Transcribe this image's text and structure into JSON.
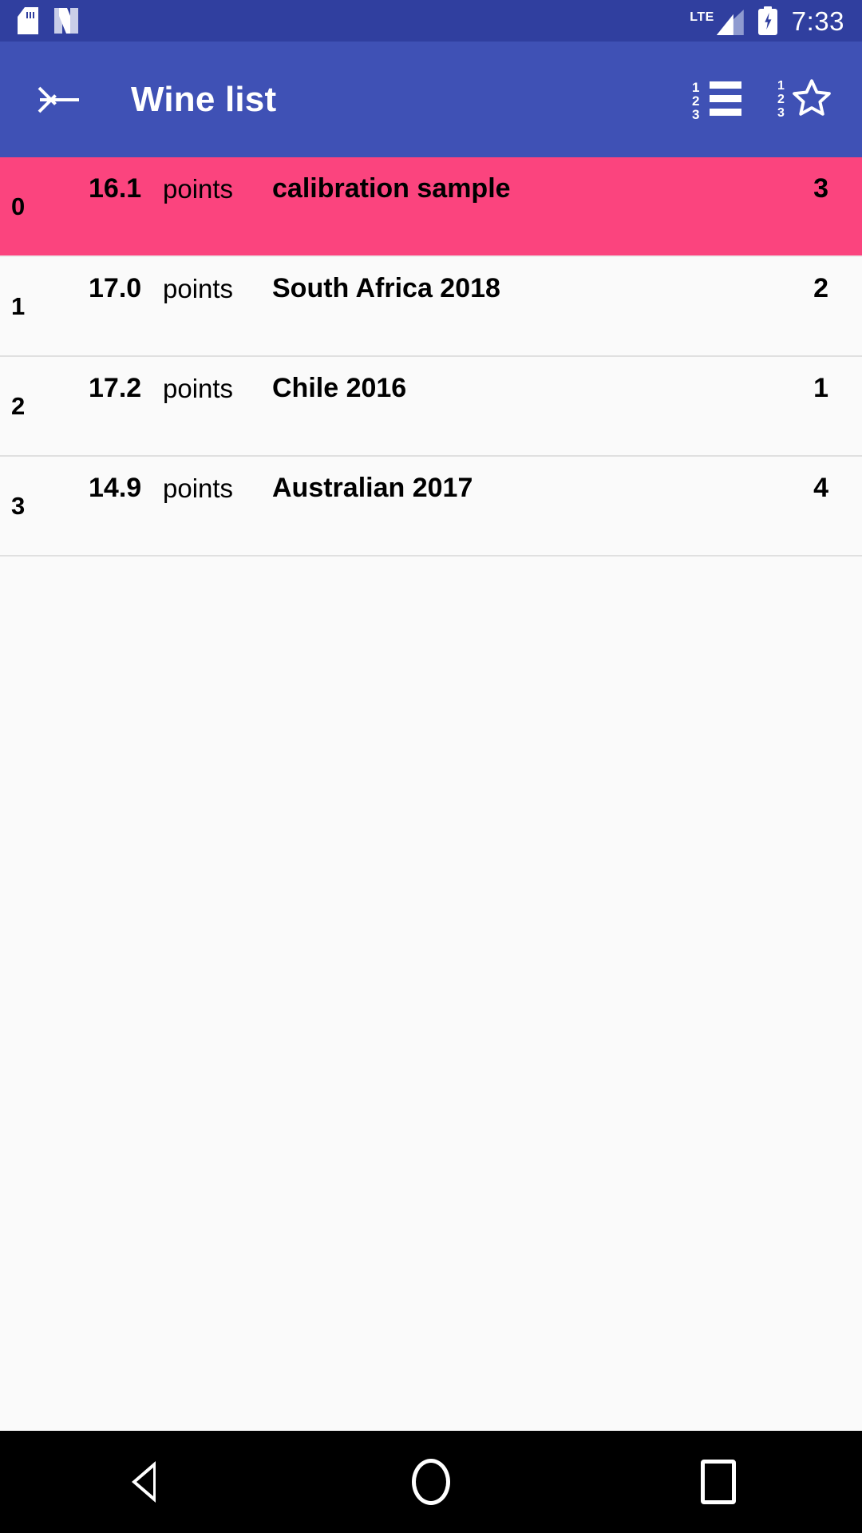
{
  "status_bar": {
    "icons": [
      "sdcard-icon",
      "nougat-icon"
    ],
    "network_label": "LTE",
    "battery_state": "charging",
    "time": "7:33",
    "background_color": "#303F9F"
  },
  "toolbar": {
    "back_label": "back-arrow-icon",
    "title": "Wine list",
    "background_color": "#3F51B5",
    "actions": [
      {
        "name": "sort-by-number-icon",
        "digits": [
          "1",
          "2",
          "3"
        ]
      },
      {
        "name": "sort-by-rating-icon",
        "digits": [
          "1",
          "2",
          "3"
        ]
      }
    ]
  },
  "list": {
    "unit_label": "points",
    "highlight_color": "#FB447E",
    "rows": [
      {
        "index": "0",
        "score": "16.1",
        "unit": "points",
        "name": "calibration sample",
        "count": "3",
        "highlighted": true
      },
      {
        "index": "1",
        "score": "17.0",
        "unit": "points",
        "name": "South Africa 2018",
        "count": "2",
        "highlighted": false
      },
      {
        "index": "2",
        "score": "17.2",
        "unit": "points",
        "name": "Chile 2016",
        "count": "1",
        "highlighted": false
      },
      {
        "index": "3",
        "score": "14.9",
        "unit": "points",
        "name": "Australian 2017",
        "count": "4",
        "highlighted": false
      }
    ]
  },
  "nav_bar": {
    "buttons": [
      "nav-back-icon",
      "nav-home-icon",
      "nav-recents-icon"
    ],
    "background_color": "#000000"
  }
}
